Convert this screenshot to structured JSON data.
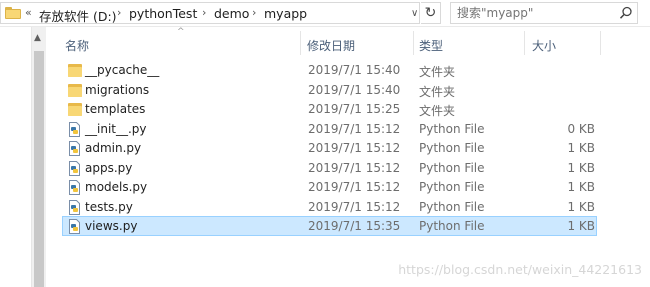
{
  "address": {
    "overflow": "«",
    "crumbs": [
      "存放软件 (D:)",
      "pythonTest",
      "demo",
      "myapp"
    ],
    "separator": "›",
    "dropdown_glyph": "∨",
    "refresh_glyph": "↻"
  },
  "search": {
    "placeholder": "搜索\"myapp\""
  },
  "columns": {
    "name": "名称",
    "date": "修改日期",
    "type": "类型",
    "size": "大小",
    "sort_glyph": "^"
  },
  "nav": {
    "scroll_up": "▲"
  },
  "files": [
    {
      "name": "__pycache__",
      "date": "2019/7/1 15:40",
      "type": "文件夹",
      "size": "",
      "icon": "folder-icon",
      "selected": false
    },
    {
      "name": "migrations",
      "date": "2019/7/1 15:40",
      "type": "文件夹",
      "size": "",
      "icon": "folder-icon",
      "selected": false
    },
    {
      "name": "templates",
      "date": "2019/7/1 15:25",
      "type": "文件夹",
      "size": "",
      "icon": "folder-icon",
      "selected": false
    },
    {
      "name": "__init__.py",
      "date": "2019/7/1 15:12",
      "type": "Python File",
      "size": "0 KB",
      "icon": "python-file-icon",
      "selected": false
    },
    {
      "name": "admin.py",
      "date": "2019/7/1 15:12",
      "type": "Python File",
      "size": "1 KB",
      "icon": "python-file-icon",
      "selected": false
    },
    {
      "name": "apps.py",
      "date": "2019/7/1 15:12",
      "type": "Python File",
      "size": "1 KB",
      "icon": "python-file-icon",
      "selected": false
    },
    {
      "name": "models.py",
      "date": "2019/7/1 15:12",
      "type": "Python File",
      "size": "1 KB",
      "icon": "python-file-icon",
      "selected": false
    },
    {
      "name": "tests.py",
      "date": "2019/7/1 15:12",
      "type": "Python File",
      "size": "1 KB",
      "icon": "python-file-icon",
      "selected": false
    },
    {
      "name": "views.py",
      "date": "2019/7/1 15:35",
      "type": "Python File",
      "size": "1 KB",
      "icon": "python-file-icon",
      "selected": true
    }
  ],
  "watermark": "https://blog.csdn.net/weixin_44221613",
  "colors": {
    "selection_bg": "#cce8ff",
    "selection_border": "#99d1ff",
    "header_text": "#4c607a",
    "folder": "#f8d775"
  }
}
